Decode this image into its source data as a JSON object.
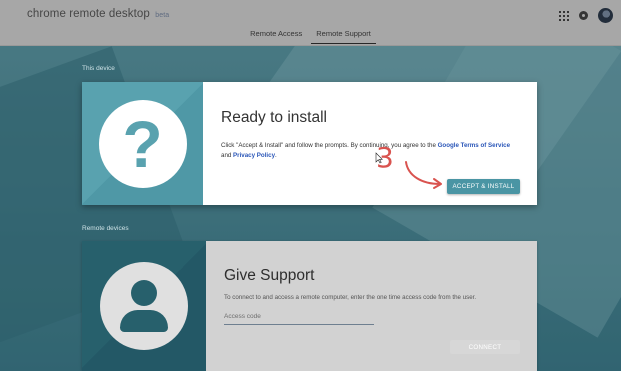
{
  "app": {
    "title": "chrome remote desktop",
    "badge": "beta"
  },
  "tabs": [
    {
      "label": "Remote Access",
      "active": false
    },
    {
      "label": "Remote Support",
      "active": true
    }
  ],
  "sections": {
    "this_device": "This device",
    "remote_devices": "Remote devices"
  },
  "install_card": {
    "icon": "question-mark-icon",
    "title": "Ready to install",
    "desc_prefix": "Click \"Accept & Install\" and follow the prompts. By continuing, you agree to the ",
    "terms_link": "Google Terms of Service",
    "desc_mid": " and ",
    "privacy_link": "Privacy Policy",
    "desc_suffix": ".",
    "accept_button": "ACCEPT & INSTALL"
  },
  "support_card": {
    "icon": "person-icon",
    "title": "Give Support",
    "description": "To connect to and access a remote computer, enter the one time access code from the user.",
    "access_placeholder": "Access code",
    "connect_button": "CONNECT"
  },
  "annotation": {
    "step_number": "3",
    "color": "#d9534f"
  },
  "colors": {
    "accent": "#4a95a4",
    "background": "#4d8f9d",
    "link": "#2a56b8"
  }
}
